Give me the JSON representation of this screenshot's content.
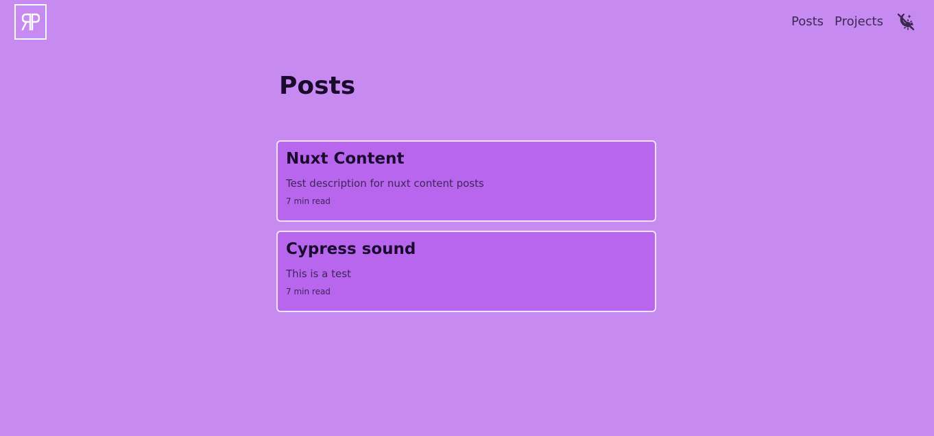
{
  "header": {
    "logo_text": "ЯP",
    "logo_icon": "rp-monogram-logo",
    "nav": [
      {
        "label": "Posts"
      },
      {
        "label": "Projects"
      }
    ],
    "theme_toggle_icon": "moon-sun-toggle-icon"
  },
  "main": {
    "title": "Posts",
    "posts": [
      {
        "title": "Nuxt Content",
        "description": "Test description for nuxt content posts",
        "read_time": "7 min read"
      },
      {
        "title": "Cypress sound",
        "description": "This is a test",
        "read_time": "7 min read"
      }
    ]
  },
  "colors": {
    "background": "#c78af0",
    "card_background": "#b866ee",
    "card_border": "#f2e4fb",
    "text_dark": "#1a0a2e",
    "text_muted": "#3d2656"
  }
}
